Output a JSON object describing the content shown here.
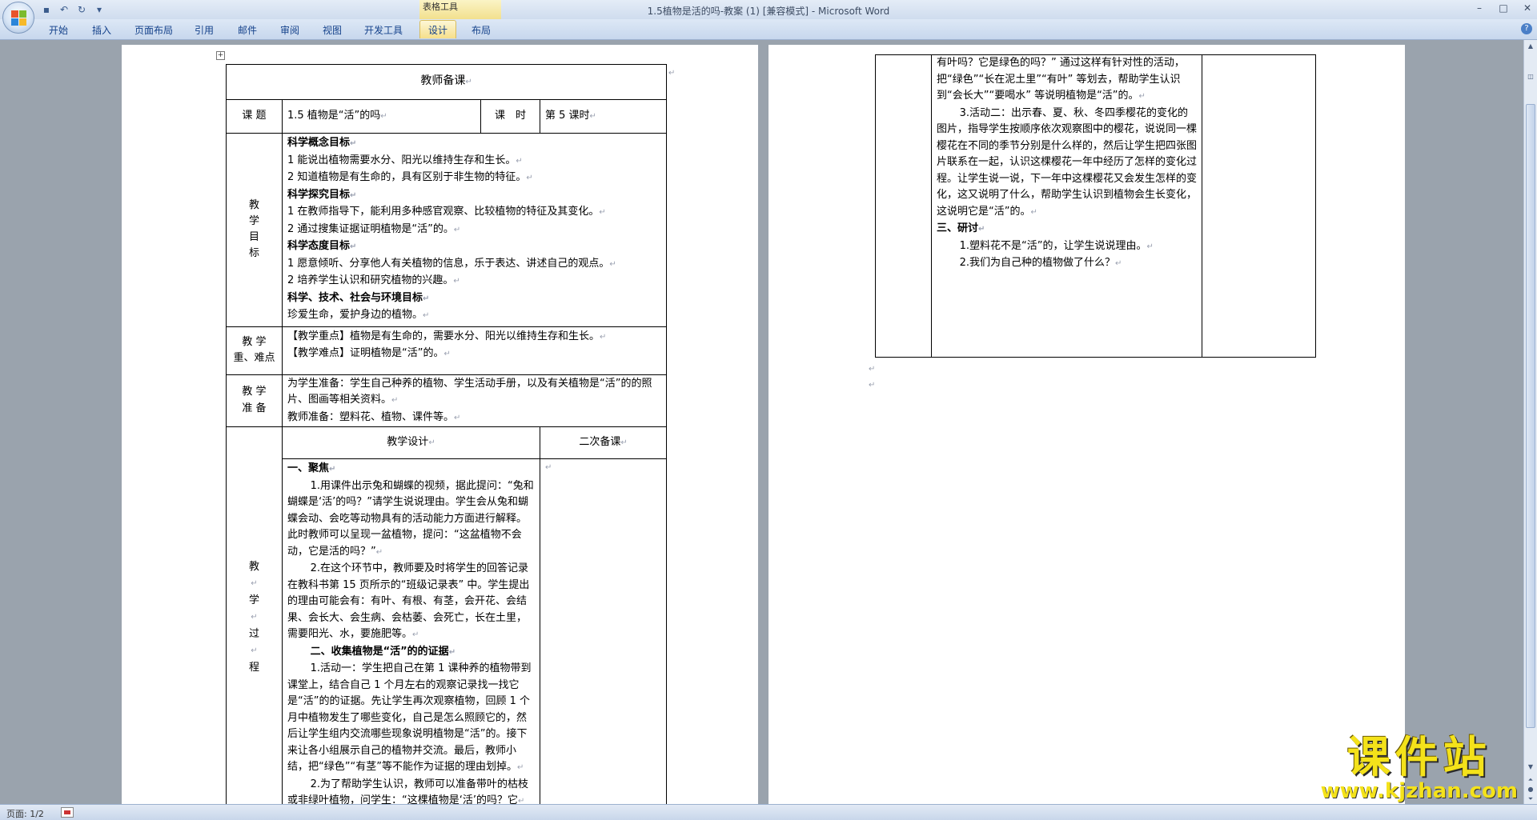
{
  "window": {
    "title": "1.5植物是活的吗-教案 (1) [兼容模式] - Microsoft Word",
    "contextual_tab": "表格工具"
  },
  "ribbon": {
    "tabs": [
      "开始",
      "插入",
      "页面布局",
      "引用",
      "邮件",
      "审阅",
      "视图",
      "开发工具",
      "设计",
      "布局"
    ],
    "active_tab": "设计"
  },
  "icons": {
    "office": "office-button-icon",
    "save": "save-icon",
    "undo": "undo-icon",
    "redo": "redo-icon",
    "customize": "customize-qat-icon",
    "help": "help-icon"
  },
  "doc": {
    "header": "教师备课",
    "topic_label": "课 题",
    "topic": "1.5 植物是“活”的吗",
    "period_label": "课　时",
    "period": "第 5 课时",
    "objectives_label": "教学目标",
    "objectives": [
      {
        "t": "科学概念目标",
        "b": true
      },
      {
        "t": "1 能说出植物需要水分、阳光以维持生存和生长。",
        "b": false
      },
      {
        "t": "2 知道植物是有生命的，具有区别于非生物的特征。",
        "b": false
      },
      {
        "t": "科学探究目标",
        "b": true
      },
      {
        "t": "1 在教师指导下，能利用多种感官观察、比较植物的特征及其变化。",
        "b": false
      },
      {
        "t": "2 通过搜集证据证明植物是“活”的。",
        "b": false
      },
      {
        "t": "科学态度目标",
        "b": true
      },
      {
        "t": "1 愿意倾听、分享他人有关植物的信息，乐于表达、讲述自己的观点。",
        "b": false
      },
      {
        "t": "2 培养学生认识和研究植物的兴趣。",
        "b": false
      },
      {
        "t": "科学、技术、社会与环境目标",
        "b": true
      },
      {
        "t": "珍爱生命，爱护身边的植物。",
        "b": false
      }
    ],
    "key_label_1": "教 学",
    "key_label_2": "重、难点",
    "key_points": [
      "【教学重点】植物是有生命的，需要水分、阳光以维持生存和生长。",
      "【教学难点】证明植物是“活”的。"
    ],
    "prep_label_1": "教 学",
    "prep_label_2": "准 备",
    "prep": [
      "为学生准备：学生自己种养的植物、学生活动手册，以及有关植物是“活”的的照片、图画等相关资料。",
      "教师准备：塑料花、植物、课件等。"
    ],
    "process_label": [
      "教",
      "学",
      "过",
      "程"
    ],
    "design_header": "教学设计",
    "second_header": "二次备课",
    "process": [
      {
        "t": "一、聚焦",
        "cls": "b"
      },
      {
        "t": "1.用课件出示兔和蝴蝶的视频，据此提问：“兔和蝴蝶是‘活’的吗？”请学生说说理由。学生会从兔和蝴蝶会动、会吃等动物具有的活动能力方面进行解释。此时教师可以呈现一盆植物，提问：“这盆植物不会动，它是活的吗？”",
        "cls": "ind"
      },
      {
        "t": "2.在这个环节中，教师要及时将学生的回答记录在教科书第 15 页所示的“班级记录表” 中。学生提出的理由可能会有：有叶、有根、有茎，会开花、会结果、会长大、会生病、会枯萎、会死亡，长在土里，需要阳光、水，要施肥等。",
        "cls": "ind"
      },
      {
        "t": "二、收集植物是“活”的的证据",
        "cls": "ind b"
      },
      {
        "t": "1.活动一：学生把自己在第 1 课种养的植物带到课堂上，结合自己 1 个月左右的观察记录找一找它是“活”的的证据。先让学生再次观察植物，回顾 1 个月中植物发生了哪些变化，自己是怎么照顾它的，然后让学生组内交流哪些现象说明植物是“活”的。接下来让各小组展示自己的植物并交流。最后，教师小结，把“绿色”“有茎”等不能作为证据的理由划掉。",
        "cls": "ind"
      },
      {
        "t": "2.为了帮助学生认识，教师可以准备带叶的枯枝或非绿叶植物，问学生：“这棵植物是‘活’的吗？它",
        "cls": "ind"
      }
    ],
    "page2": [
      {
        "t": "有叶吗？它是绿色的吗？” 通过这样有针对性的活动，把“绿色”“长在泥土里”“有叶” 等划去，帮助学生认识到“会长大”“要喝水” 等说明植物是“活”的。",
        "cls": ""
      },
      {
        "t": "3.活动二：出示春、夏、秋、冬四季樱花的变化的图片，指导学生按顺序依次观察图中的樱花，说说同一棵樱花在不同的季节分别是什么样的，然后让学生把四张图片联系在一起，认识这棵樱花一年中经历了怎样的变化过程。让学生说一说，下一年中这棵樱花又会发生怎样的变化，这又说明了什么，帮助学生认识到植物会生长变化，这说明它是“活”的。",
        "cls": "ind"
      },
      {
        "t": "三、研讨",
        "cls": "b"
      },
      {
        "t": "1.塑料花不是“活”的，让学生说说理由。",
        "cls": "ind"
      },
      {
        "t": "2.我们为自己种的植物做了什么？",
        "cls": "ind"
      }
    ]
  },
  "status": {
    "page": "页面: 1/2"
  },
  "watermark": {
    "main": "课件站",
    "url": "www.kjzhan.com"
  }
}
